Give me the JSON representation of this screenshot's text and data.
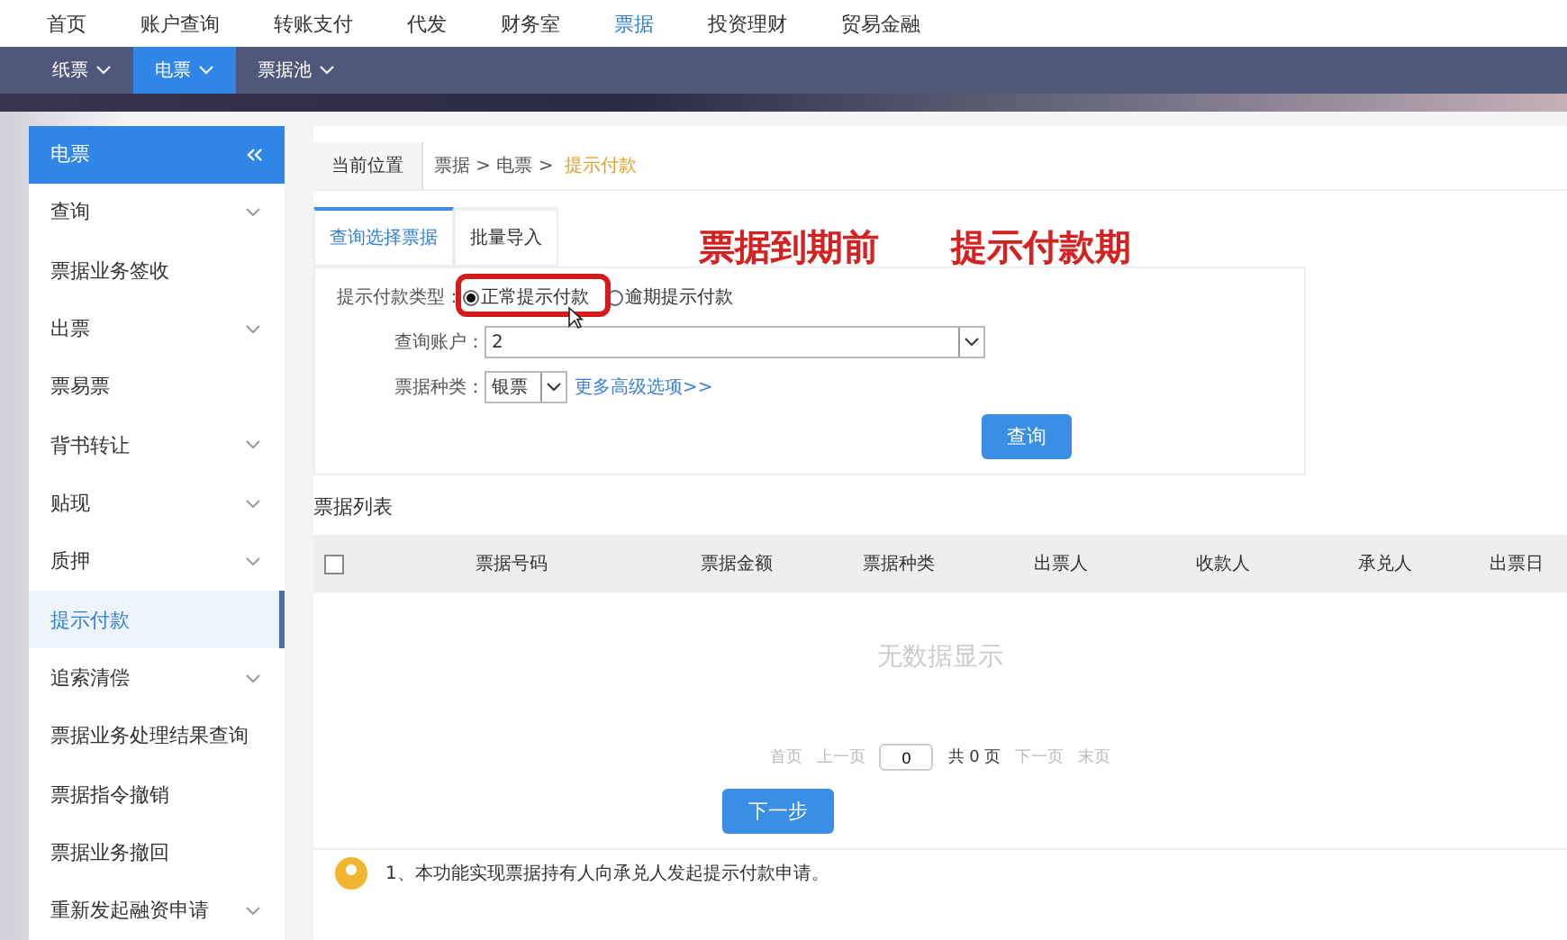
{
  "top_nav": [
    {
      "label": "首页",
      "selected": false
    },
    {
      "label": "账户查询",
      "selected": false
    },
    {
      "label": "转账支付",
      "selected": false
    },
    {
      "label": "代发",
      "selected": false
    },
    {
      "label": "财务室",
      "selected": false
    },
    {
      "label": "票据",
      "selected": true
    },
    {
      "label": "投资理财",
      "selected": false
    },
    {
      "label": "贸易金融",
      "selected": false
    }
  ],
  "sub_nav": [
    {
      "label": "纸票",
      "selected": false
    },
    {
      "label": "电票",
      "selected": true
    },
    {
      "label": "票据池",
      "selected": false
    }
  ],
  "sidebar": {
    "title": "电票",
    "items": [
      {
        "label": "查询",
        "expandable": true,
        "selected": false
      },
      {
        "label": "票据业务签收",
        "expandable": false,
        "selected": false
      },
      {
        "label": "出票",
        "expandable": true,
        "selected": false
      },
      {
        "label": "票易票",
        "expandable": false,
        "selected": false
      },
      {
        "label": "背书转让",
        "expandable": true,
        "selected": false
      },
      {
        "label": "贴现",
        "expandable": true,
        "selected": false
      },
      {
        "label": "质押",
        "expandable": true,
        "selected": false
      },
      {
        "label": "提示付款",
        "expandable": false,
        "selected": true
      },
      {
        "label": "追索清偿",
        "expandable": true,
        "selected": false
      },
      {
        "label": "票据业务处理结果查询",
        "expandable": false,
        "selected": false
      },
      {
        "label": "票据指令撤销",
        "expandable": false,
        "selected": false
      },
      {
        "label": "票据业务撤回",
        "expandable": false,
        "selected": false
      },
      {
        "label": "重新发起融资申请",
        "expandable": true,
        "selected": false
      }
    ]
  },
  "breadcrumb": {
    "location": "当前位置",
    "trail": [
      "票据",
      "电票"
    ],
    "separator": ">",
    "current": "提示付款"
  },
  "tabs": [
    {
      "label": "查询选择票据",
      "selected": true
    },
    {
      "label": "批量导入",
      "selected": false
    }
  ],
  "annotations": [
    "票据到期前",
    "提示付款期"
  ],
  "form": {
    "payment_type": {
      "label": "提示付款类型：",
      "options": [
        {
          "label": "正常提示付款",
          "selected": true
        },
        {
          "label": "逾期提示付款",
          "selected": false
        }
      ]
    },
    "account": {
      "label": "查询账户：",
      "value": "2"
    },
    "bill_type": {
      "label": "票据种类：",
      "value": "银票",
      "link": "更多高级选项>>"
    },
    "query_button": "查询"
  },
  "table": {
    "title": "票据列表",
    "select_all": false,
    "columns": [
      "票据号码",
      "票据金额",
      "票据种类",
      "出票人",
      "收款人",
      "承兑人",
      "出票日"
    ],
    "empty_text": "无数据显示"
  },
  "pagination": {
    "first": "首页",
    "prev": "上一页",
    "page": "0",
    "total": "共 0 页",
    "next": "下一页",
    "last": "末页"
  },
  "next_button": "下一步",
  "notes": [
    "1、本功能实现票据持有人向承兑人发起提示付款申请。"
  ]
}
